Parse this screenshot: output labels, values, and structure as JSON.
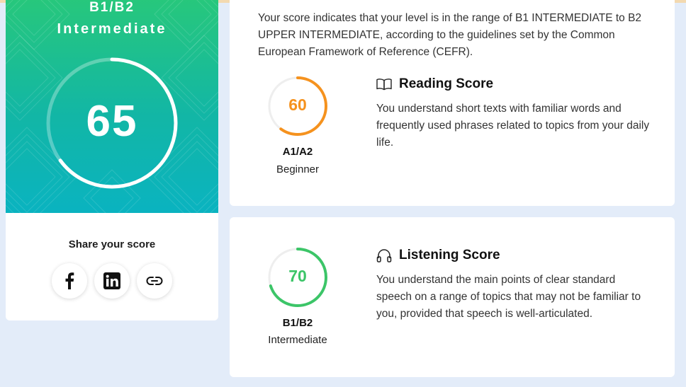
{
  "overall": {
    "level": "B1/B2",
    "label": "Intermediate",
    "score": "65",
    "score_fraction": 0.65,
    "gradient_top": "#27c77c",
    "gradient_bottom": "#0ab3c0"
  },
  "share": {
    "title": "Share your score",
    "buttons": [
      {
        "icon": "facebook-icon"
      },
      {
        "icon": "linkedin-icon"
      },
      {
        "icon": "link-icon"
      }
    ]
  },
  "intro": "Your score indicates that your level is in the range of B1 INTERMEDIATE to B2 UPPER INTERMEDIATE, according to the guidelines set by the Common European Framework of Reference (CEFR).",
  "reading": {
    "title": "Reading Score",
    "icon": "book-icon",
    "score": "60",
    "score_fraction": 0.6,
    "level_code": "A1/A2",
    "level_name": "Beginner",
    "description": "You understand short texts with familiar words and frequently used phrases related to topics from your daily life.",
    "color": "#f5921e"
  },
  "listening": {
    "title": "Listening Score",
    "icon": "headphones-icon",
    "score": "70",
    "score_fraction": 0.7,
    "level_code": "B1/B2",
    "level_name": "Intermediate",
    "description": "You understand the main points of clear standard speech on a range of topics that may not be familiar to you, provided that speech is well-articulated.",
    "color": "#3cc568"
  }
}
